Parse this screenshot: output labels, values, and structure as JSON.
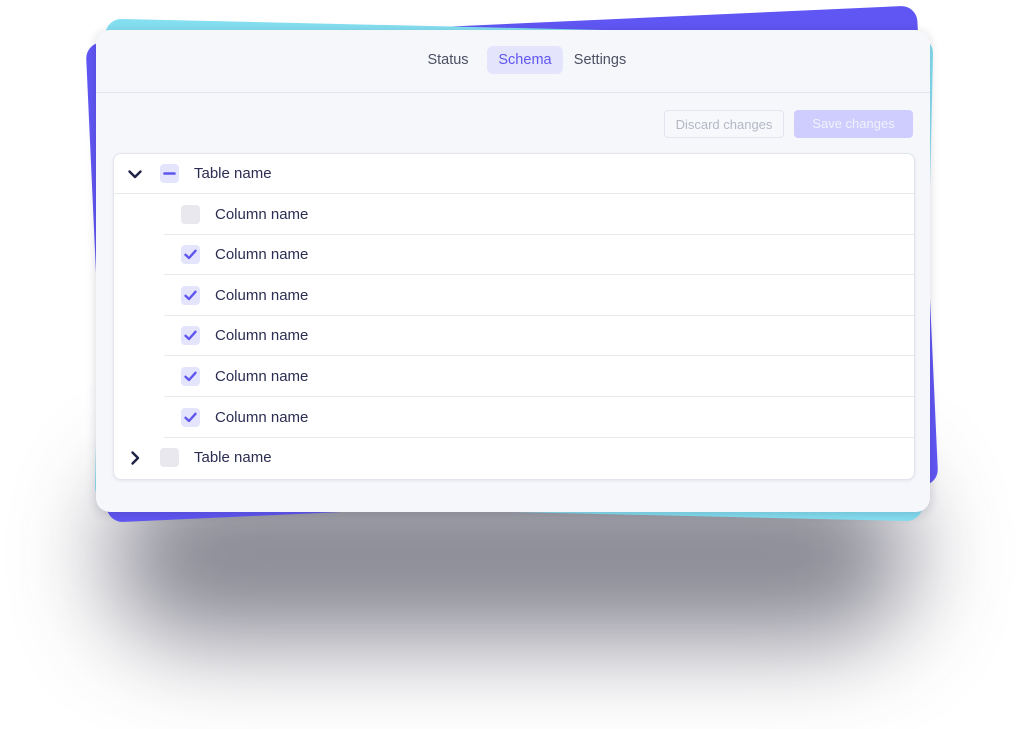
{
  "tabs": [
    {
      "label": "Status",
      "active": false
    },
    {
      "label": "Schema",
      "active": true
    },
    {
      "label": "Settings",
      "active": false
    }
  ],
  "actions": {
    "discard_label": "Discard changes",
    "save_label": "Save changes"
  },
  "tables": [
    {
      "name": "Table name",
      "expanded": true,
      "selection": "partial",
      "columns": [
        {
          "name": "Column name",
          "checked": false
        },
        {
          "name": "Column name",
          "checked": true
        },
        {
          "name": "Column name",
          "checked": true
        },
        {
          "name": "Column name",
          "checked": true
        },
        {
          "name": "Column name",
          "checked": true
        },
        {
          "name": "Column name",
          "checked": true
        }
      ]
    },
    {
      "name": "Table name",
      "expanded": false,
      "selection": "none",
      "columns": []
    }
  ],
  "icons": {
    "expanded": "chevron-down-icon",
    "collapsed": "chevron-right-icon",
    "checked": "checkmark-icon",
    "partial": "minus-icon"
  },
  "colors": {
    "accent": "#5f56ee",
    "accent_soft": "#e4e4fd",
    "text": "#2b2d52",
    "back_card_purple": "#6056f3",
    "back_card_cyan": "#84dff0"
  }
}
